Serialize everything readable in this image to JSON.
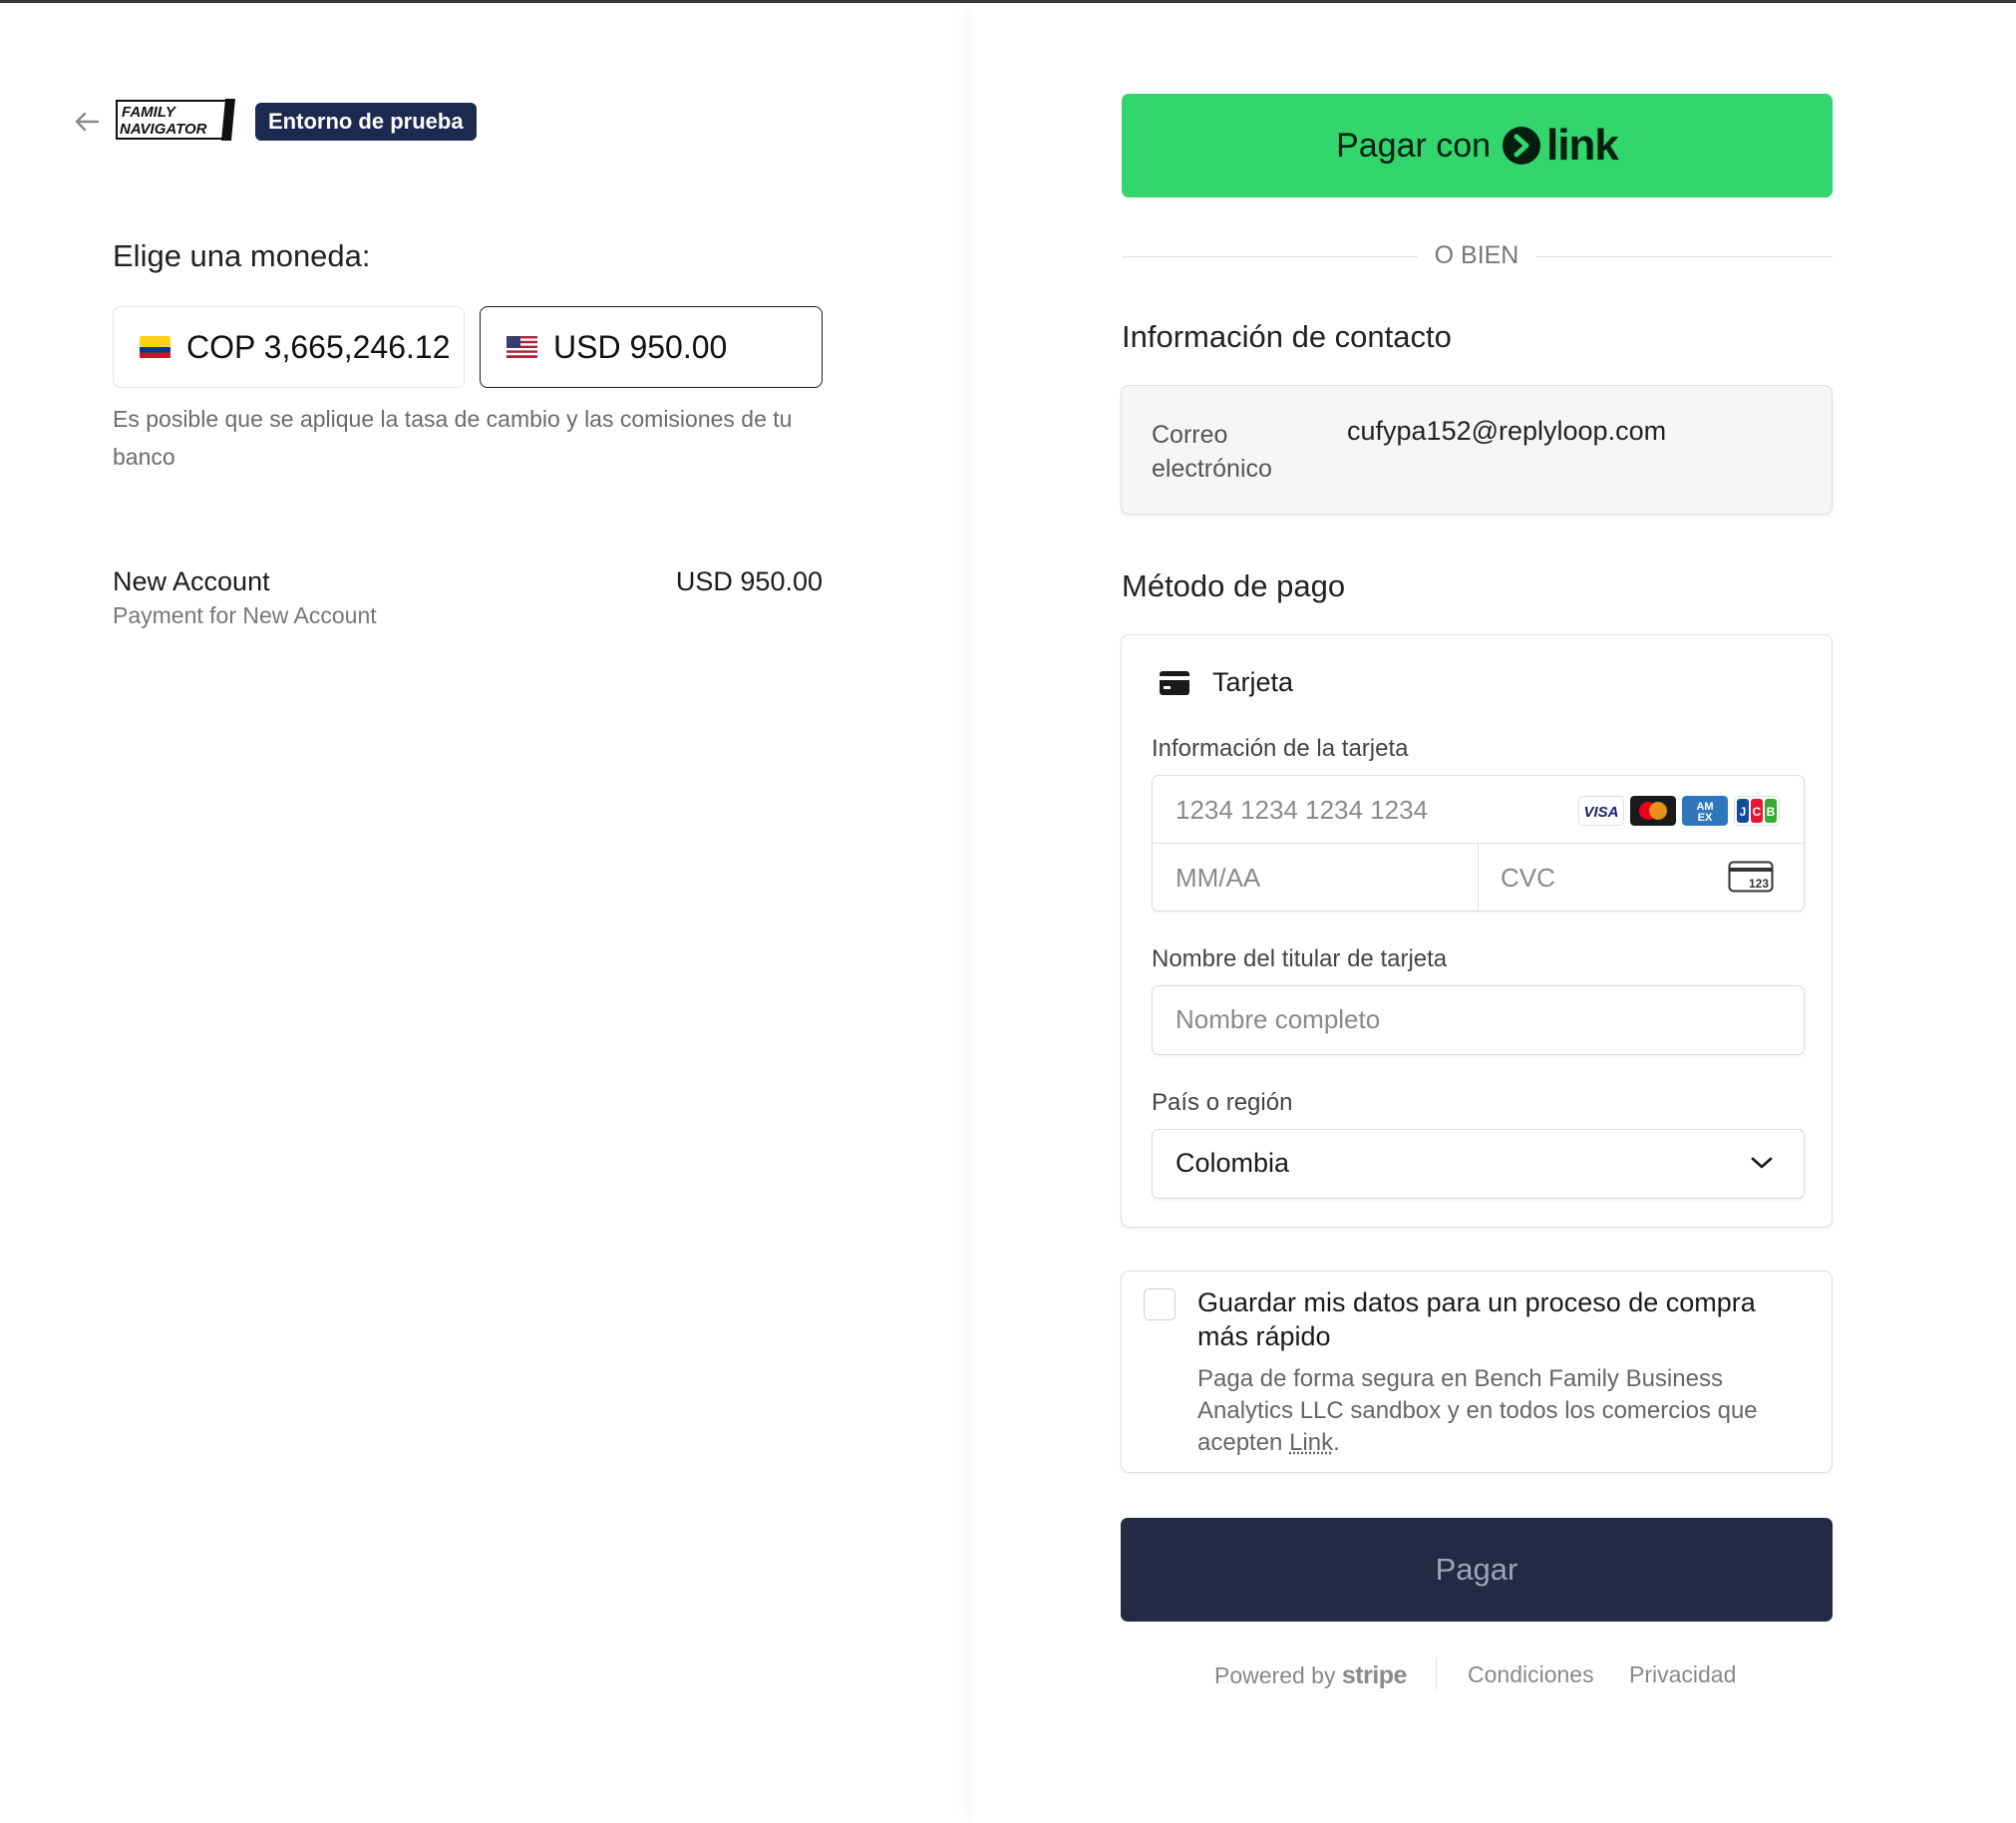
{
  "header": {
    "logo_text": [
      "FAMILY",
      "NAVIGATOR"
    ],
    "sandbox_badge": "Entorno de prueba"
  },
  "currency": {
    "title": "Elige una moneda:",
    "options": [
      {
        "label": "COP 3,665,246.12",
        "flag": "colombia-flag",
        "selected": false
      },
      {
        "label": "USD 950.00",
        "flag": "us-flag",
        "selected": true
      }
    ],
    "note": "Es posible que se aplique la tasa de cambio y las comisiones de tu banco"
  },
  "order": {
    "item_name": "New Account",
    "item_description": "Payment for New Account",
    "item_price": "USD 950.00"
  },
  "link_button": {
    "prefix": "Pagar con",
    "brand": "link"
  },
  "divider_text": "O BIEN",
  "contact": {
    "title": "Información de contacto",
    "email_label": "Correo electrónico",
    "email_value": "cufypa152@replyloop.com"
  },
  "payment": {
    "title": "Método de pago",
    "tab_label": "Tarjeta",
    "card_info_label": "Información de la tarjeta",
    "card_number_placeholder": "1234 1234 1234 1234",
    "expiry_placeholder": "MM/AA",
    "cvc_placeholder": "CVC",
    "cvc_icon_text": "123",
    "card_brands": [
      "visa",
      "mastercard",
      "amex",
      "jcb"
    ],
    "cardholder_label": "Nombre del titular de tarjeta",
    "cardholder_placeholder": "Nombre completo",
    "country_label": "País o región",
    "country_value": "Colombia"
  },
  "save": {
    "title": "Guardar mis datos para un proceso de compra más rápido",
    "description_prefix": "Paga de forma segura en Bench Family Business Analytics LLC sandbox y en todos los comercios que acepten ",
    "link_text": "Link",
    "description_suffix": "."
  },
  "pay_button": "Pagar",
  "footer": {
    "powered_prefix": "Powered by",
    "powered_brand": "stripe",
    "terms": "Condiciones",
    "privacy": "Privacidad"
  },
  "colors": {
    "link_green": "#33d66d",
    "pay_button_bg": "#232a45",
    "badge_bg": "#1b2a4e"
  }
}
